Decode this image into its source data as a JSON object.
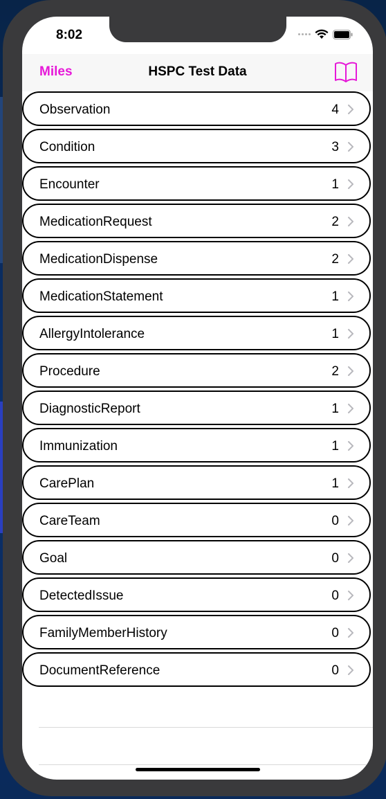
{
  "status_bar": {
    "time": "8:02"
  },
  "nav": {
    "back_label": "Miles",
    "title": "HSPC Test Data",
    "right_icon": "book-icon",
    "accent_color": "#e619d8"
  },
  "resources": [
    {
      "label": "Observation",
      "count": "4"
    },
    {
      "label": "Condition",
      "count": "3"
    },
    {
      "label": "Encounter",
      "count": "1"
    },
    {
      "label": "MedicationRequest",
      "count": "2"
    },
    {
      "label": "MedicationDispense",
      "count": "2"
    },
    {
      "label": "MedicationStatement",
      "count": "1"
    },
    {
      "label": "AllergyIntolerance",
      "count": "1"
    },
    {
      "label": "Procedure",
      "count": "2"
    },
    {
      "label": "DiagnosticReport",
      "count": "1"
    },
    {
      "label": "Immunization",
      "count": "1"
    },
    {
      "label": "CarePlan",
      "count": "1"
    },
    {
      "label": "CareTeam",
      "count": "0"
    },
    {
      "label": "Goal",
      "count": "0"
    },
    {
      "label": "DetectedIssue",
      "count": "0"
    },
    {
      "label": "FamilyMemberHistory",
      "count": "0"
    },
    {
      "label": "DocumentReference",
      "count": "0"
    }
  ]
}
